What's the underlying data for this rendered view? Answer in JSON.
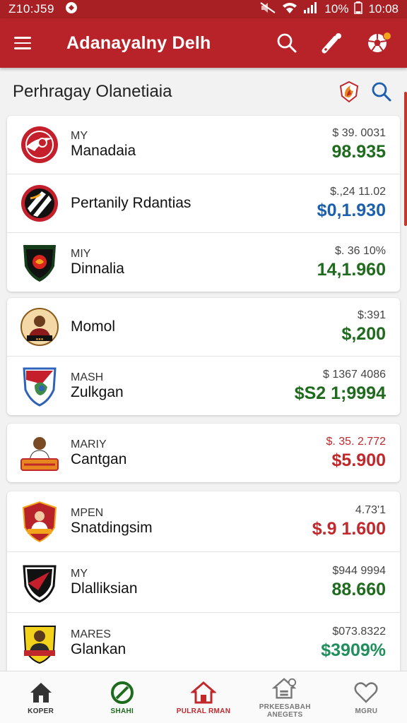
{
  "status_bar": {
    "time_left": "Z10:J59",
    "battery": "10%",
    "time_right": "10:08"
  },
  "app_bar": {
    "title": "Adanayalny Delh",
    "icons": [
      "menu-icon",
      "search-icon",
      "brush-icon",
      "ball-icon"
    ]
  },
  "section": {
    "title": "Perhragay Olanetiaia"
  },
  "colors": {
    "brand": "#b8232a",
    "green": "#1e6b1e",
    "blue": "#1b5fae",
    "red": "#c0282c",
    "teal": "#1f8f5c"
  },
  "groups": [
    {
      "rows": [
        {
          "abbr": "MY",
          "name": "Manadaia",
          "small": "$ 39. 0031",
          "big": "98.935",
          "color": "#1e6b1e",
          "logo": "red-circle-logo"
        },
        {
          "abbr": "",
          "name": "Pertanily Rdantias",
          "small": "$.,24 11.02",
          "big": "$0,1.930",
          "color": "#1b5fae",
          "logo": "striped-circle-logo"
        },
        {
          "abbr": "MIY",
          "name": "Dinnalia",
          "small": "$. 36 10%",
          "big": "14,1.960",
          "color": "#1e6b1e",
          "logo": "shield-logo"
        }
      ]
    },
    {
      "rows": [
        {
          "abbr": "",
          "name": "Momol",
          "small": "$:391",
          "big": "$,200",
          "color": "#1e6b1e",
          "logo": "player-circle-logo"
        },
        {
          "abbr": "MASH",
          "name": "Zulkgan",
          "small": "$ 1367 4086",
          "big": "$S2 1;9994",
          "color": "#1e6b1e",
          "logo": "blue-shield-logo"
        }
      ]
    },
    {
      "rows": [
        {
          "abbr": "MARIY",
          "name": "Cantgan",
          "small": "$. 35. 2.772",
          "big": "$5.900",
          "color": "#c0282c",
          "small_color": "#c0282c",
          "logo": "player-badge-logo"
        }
      ]
    },
    {
      "rows": [
        {
          "abbr": "MPEN",
          "name": "Snatdingsim",
          "small": "4.73'1",
          "big": "$.9 1.600",
          "color": "#c0282c",
          "logo": "red-crest-logo"
        },
        {
          "abbr": "MY",
          "name": "Dlalliksian",
          "small": "$944 9994",
          "big": "88.660",
          "color": "#1e6b1e",
          "logo": "black-shield-logo"
        },
        {
          "abbr": "MARES",
          "name": "Glankan",
          "small": "$073.8322",
          "big": "$3909%",
          "color": "#1f8f5c",
          "logo": "yellow-player-logo"
        }
      ]
    }
  ],
  "bottom_nav": [
    {
      "label": "KOPER",
      "icon": "home-icon",
      "color": "#333333"
    },
    {
      "label": "SHAHI",
      "icon": "no-circle-icon",
      "color": "#1e6b1e"
    },
    {
      "label": "PULRAL RMAN",
      "icon": "house-active-icon",
      "color": "#c0282c"
    },
    {
      "label": "PRKEESABAH ANEGETS",
      "icon": "settings-house-icon",
      "color": "#777777"
    },
    {
      "label": "MGRU",
      "icon": "heart-icon",
      "color": "#777777"
    }
  ]
}
